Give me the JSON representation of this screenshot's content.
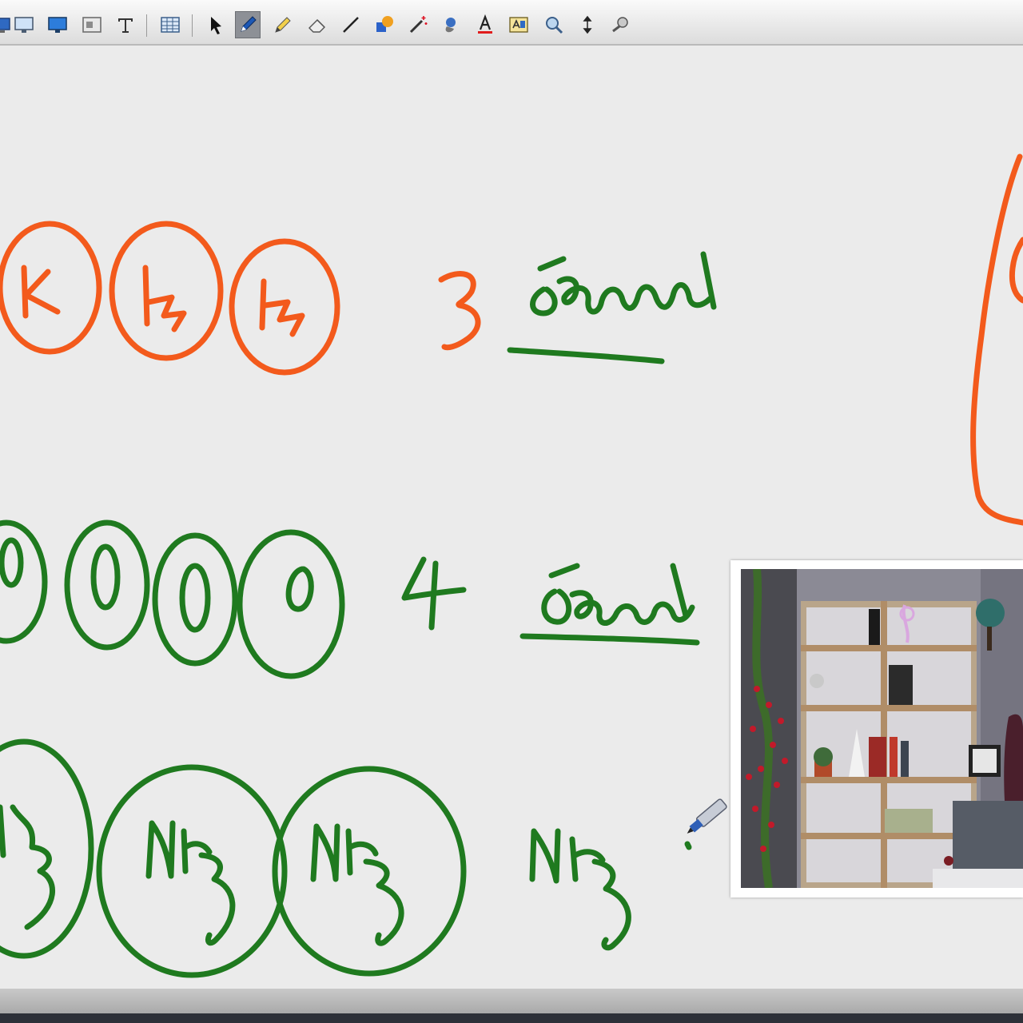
{
  "toolbar": {
    "tools": [
      {
        "name": "display-icon",
        "active": false
      },
      {
        "name": "monitor-icon",
        "active": false
      },
      {
        "name": "monitor-blue-icon",
        "active": false
      },
      {
        "name": "slide-icon",
        "active": false
      },
      {
        "name": "text-box-icon",
        "active": false
      },
      {
        "name": "table-icon",
        "active": false
      },
      {
        "name": "select-arrow-icon",
        "active": false
      },
      {
        "name": "pen-icon",
        "active": true
      },
      {
        "name": "pencil-icon",
        "active": false
      },
      {
        "name": "eraser-icon",
        "active": false
      },
      {
        "name": "line-icon",
        "active": false
      },
      {
        "name": "shapes-icon",
        "active": false
      },
      {
        "name": "magic-wand-icon",
        "active": false
      },
      {
        "name": "fill-icon",
        "active": false
      },
      {
        "name": "text-color-icon",
        "active": false
      },
      {
        "name": "insert-text-icon",
        "active": false
      },
      {
        "name": "zoom-icon",
        "active": false
      },
      {
        "name": "move-vertical-icon",
        "active": false
      },
      {
        "name": "settings-icon",
        "active": false
      }
    ]
  },
  "colors": {
    "ink_orange": "#f35a1c",
    "ink_green": "#1f7a1f",
    "board_background": "#ebebeb",
    "active_tool": "#8d9096"
  },
  "board": {
    "row1_count": "3",
    "row2_count": "4",
    "row3_label": "NH"
  }
}
